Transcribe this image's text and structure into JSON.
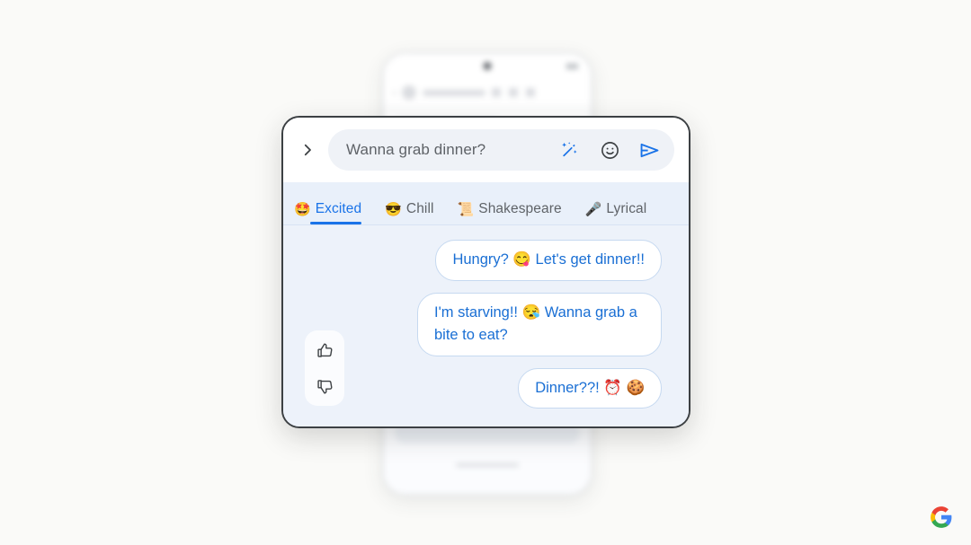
{
  "background_color": "#FAFAF8",
  "phone_mockup": {
    "name": "blurred-phone-conversation-mockup",
    "visible": true
  },
  "panel": {
    "border_color": "#3C4043",
    "background": "#EDF2FA"
  },
  "compose": {
    "expand_icon": "chevron-right-icon",
    "input_value": "Wanna grab dinner?",
    "input_placeholder": "Wanna grab dinner?",
    "actions": [
      {
        "name": "magic-wand-icon",
        "label": "Magic compose"
      },
      {
        "name": "emoji-icon",
        "label": "Emoji"
      },
      {
        "name": "send-icon",
        "label": "Send"
      }
    ],
    "accent_color": "#1A73E8"
  },
  "tabs": {
    "active_index": 0,
    "items": [
      {
        "emoji": "🤩",
        "label": "Excited",
        "icon_name": "star-struck-emoji"
      },
      {
        "emoji": "😎",
        "label": "Chill",
        "icon_name": "sunglasses-emoji"
      },
      {
        "emoji": "📜",
        "label": "Shakespeare",
        "icon_name": "scroll-emoji"
      },
      {
        "emoji": "🎤",
        "label": "Lyrical",
        "icon_name": "microphone-emoji"
      }
    ]
  },
  "suggestions": {
    "bubbles": [
      {
        "text": "Hungry? 😋 Let's get dinner!!"
      },
      {
        "text": "I'm starving!! 😪 Wanna grab a bite to eat?"
      },
      {
        "text": "Dinner??! ⏰ 🍪"
      }
    ],
    "text_color": "#1A6FD4",
    "border_color": "#C6D9F0"
  },
  "feedback": {
    "thumbs_up": "thumb-up-icon",
    "thumbs_down": "thumb-down-icon"
  },
  "branding": {
    "logo": "google-g-logo",
    "colors": {
      "blue": "#4285F4",
      "red": "#EA4335",
      "yellow": "#FBBC05",
      "green": "#34A853"
    }
  }
}
